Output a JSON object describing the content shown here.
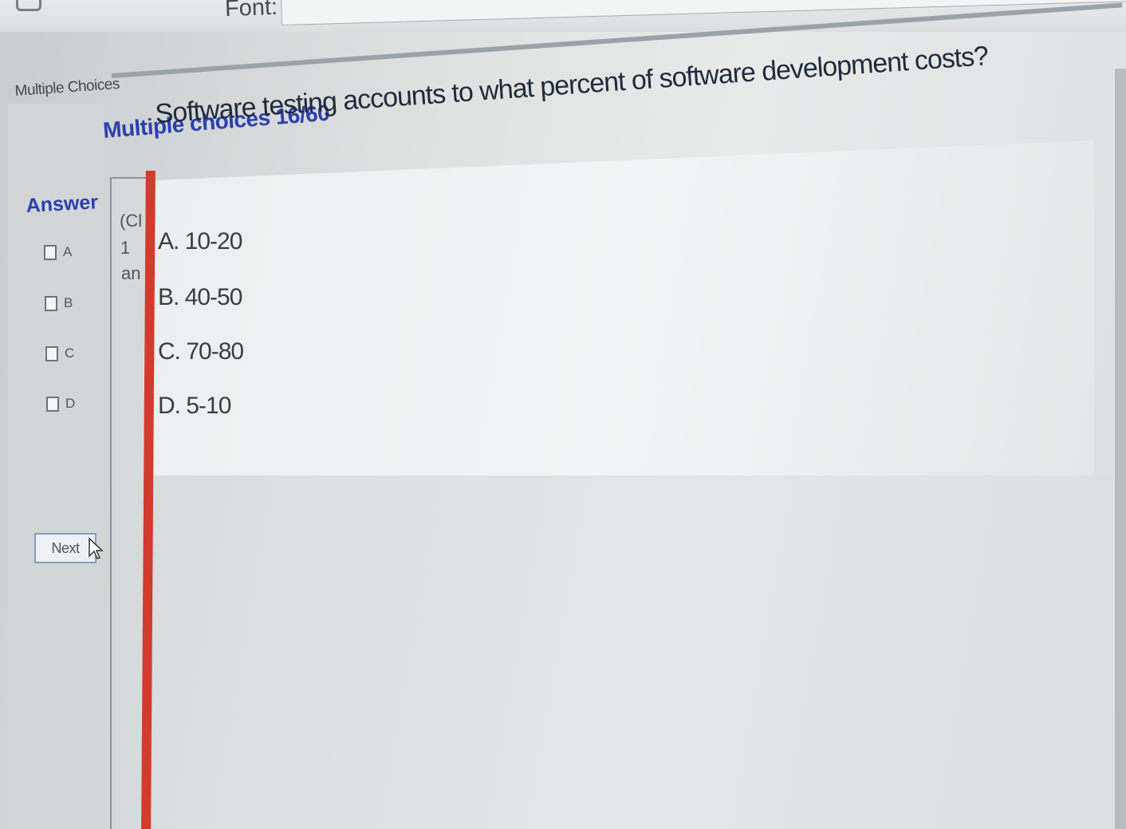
{
  "toolbar": {
    "font_label": "Font:"
  },
  "section": {
    "title": "Multiple Choices"
  },
  "quiz": {
    "heading": "Multiple choices 16/60",
    "answer_label": "Answer",
    "choices": [
      {
        "label": "A"
      },
      {
        "label": "B"
      },
      {
        "label": "C"
      },
      {
        "label": "D"
      }
    ],
    "next_label": "Next",
    "instructions": {
      "line1": "(Cl",
      "line2": "1",
      "line3": "an"
    },
    "question": "Software testing accounts to what percent of software development costs?",
    "options": [
      {
        "text": "A.  10-20"
      },
      {
        "text": "B.  40-50"
      },
      {
        "text": "C.  70-80"
      },
      {
        "text": "D.  5-10"
      }
    ]
  },
  "colors": {
    "heading_blue": "#2c3fb0",
    "red_bar": "#d23b2d",
    "button_border": "#7f9fc4"
  }
}
